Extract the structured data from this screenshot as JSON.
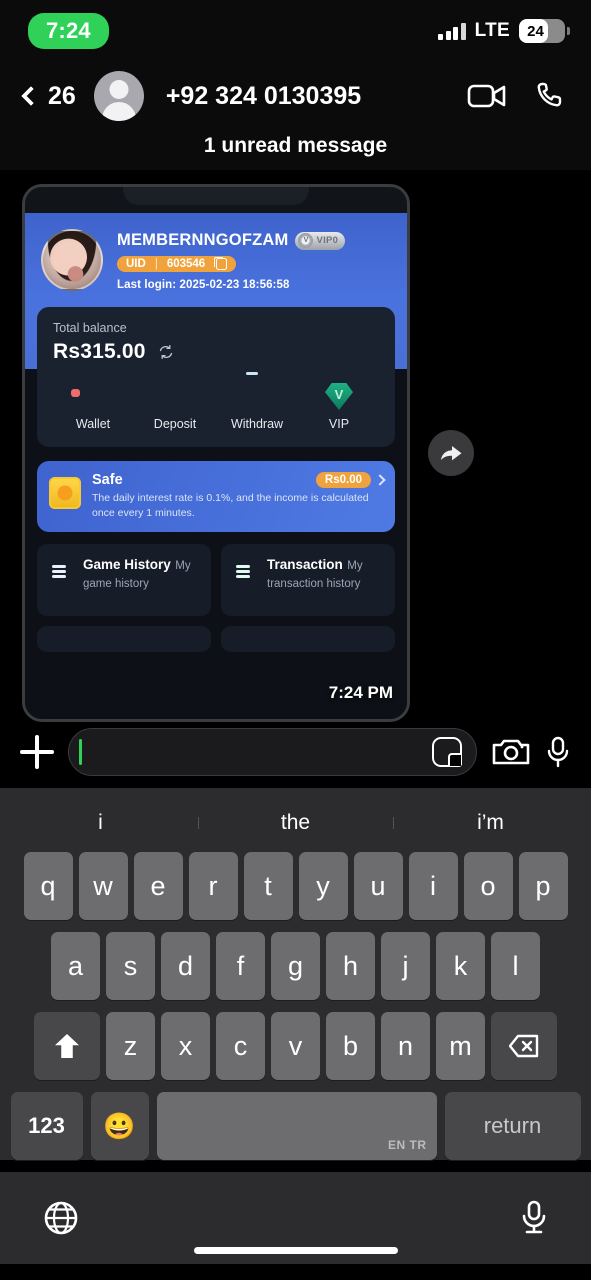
{
  "status_bar": {
    "time": "7:24",
    "network": "LTE",
    "battery_percent": "24",
    "signal_icon": "signal-bars-icon",
    "battery_icon": "battery-icon"
  },
  "nav_bar": {
    "back_count": "26",
    "contact_name": "+92 324 0130395",
    "back_icon": "chevron-left-icon",
    "avatar_icon": "contact-avatar-placeholder",
    "video_call_icon": "video-camera-icon",
    "voice_call_icon": "phone-icon"
  },
  "conversation": {
    "unread_divider": "1 unread message",
    "message_timestamp": "7:24 PM",
    "forward_icon": "forward-arrow-icon"
  },
  "attachment": {
    "profile": {
      "username": "MEMBERNNGOFZAM",
      "vip_badge": "VIP0",
      "uid_label": "UID",
      "uid_separator": "|",
      "uid_value": "603546",
      "copy_icon": "copy-icon",
      "last_login": "Last login: 2025-02-23 18:56:58",
      "avatar_icon": "user-photo-avatar"
    },
    "balance": {
      "label": "Total balance",
      "amount": "Rs315.00",
      "refresh_icon": "refresh-icon"
    },
    "quick_actions": [
      {
        "label": "Wallet",
        "icon": "wallet-icon"
      },
      {
        "label": "Deposit",
        "icon": "deposit-icon"
      },
      {
        "label": "Withdraw",
        "icon": "withdraw-card-icon"
      },
      {
        "label": "VIP",
        "icon": "vip-gem-icon"
      }
    ],
    "safe": {
      "title": "Safe",
      "description": "The daily interest rate is 0.1%, and the income is calculated once every 1 minutes.",
      "amount": "Rs0.00",
      "icon": "safe-coin-icon",
      "chevron_icon": "chevron-right-icon"
    },
    "tiles": [
      {
        "title": "Game History",
        "subtitle": "My game history",
        "icon": "game-history-doc-icon"
      },
      {
        "title": "Transaction",
        "subtitle": "My transaction history",
        "icon": "transaction-doc-icon"
      }
    ]
  },
  "input_bar": {
    "plus_icon": "plus-icon",
    "message_value": "",
    "placeholder": "",
    "sticker_icon": "sticker-icon",
    "camera_icon": "camera-icon",
    "mic_icon": "microphone-icon"
  },
  "keyboard": {
    "suggestions": [
      "i",
      "the",
      "i’m"
    ],
    "row1": [
      "q",
      "w",
      "e",
      "r",
      "t",
      "y",
      "u",
      "i",
      "o",
      "p"
    ],
    "row2": [
      "a",
      "s",
      "d",
      "f",
      "g",
      "h",
      "j",
      "k",
      "l"
    ],
    "row3": [
      "z",
      "x",
      "c",
      "v",
      "b",
      "n",
      "m"
    ],
    "shift_icon": "shift-arrow-icon",
    "delete_icon": "backspace-icon",
    "numbers_key": "123",
    "emoji_icon": "emoji-smiley-icon",
    "space_language": "EN TR",
    "return_key": "return"
  },
  "bottom_bar": {
    "globe_icon": "globe-icon",
    "dictation_icon": "microphone-icon",
    "home_indicator": "home-indicator"
  },
  "colors": {
    "accent_green": "#30d158",
    "app_blue": "#4a72de",
    "badge_orange": "#f0a33c"
  }
}
